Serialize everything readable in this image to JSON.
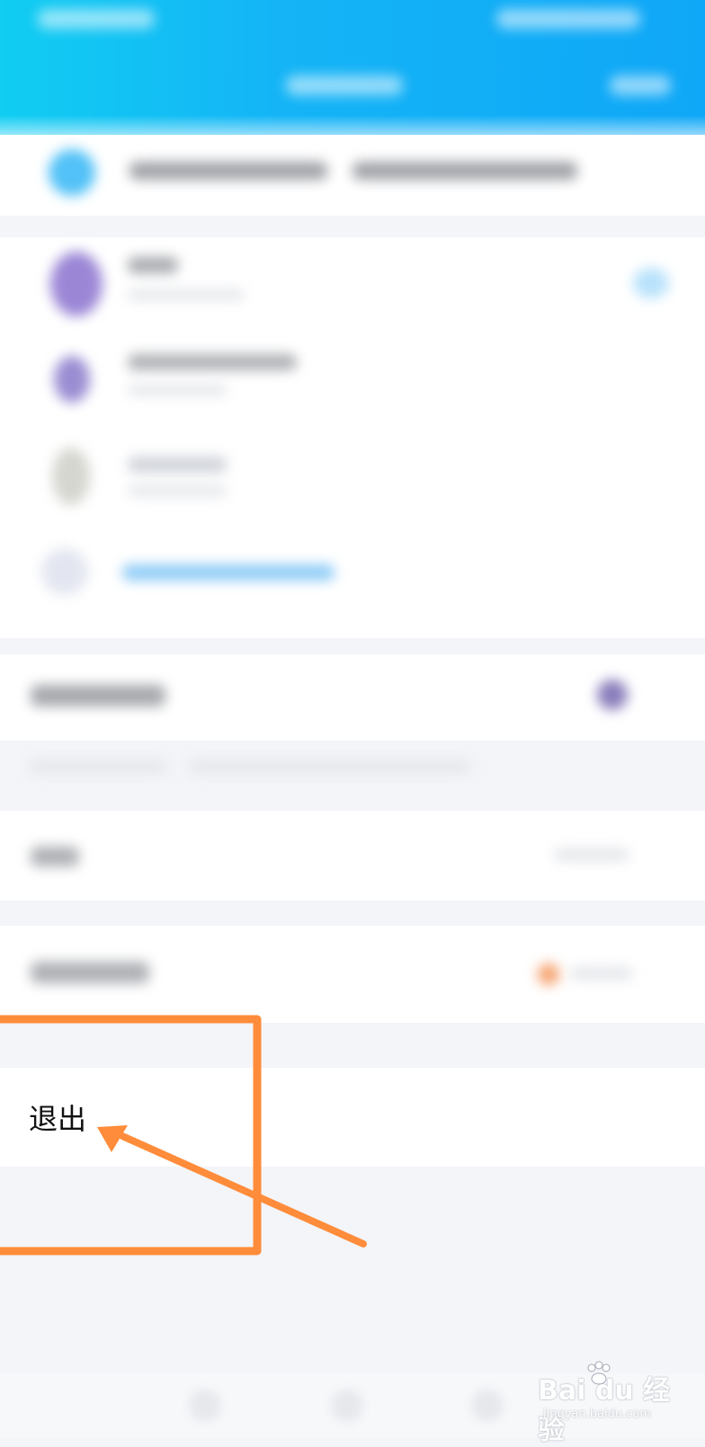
{
  "logout": {
    "label": "退出"
  },
  "watermark": {
    "brand": "Bai du 经验",
    "url": "jingyan.baidu.com"
  },
  "colors": {
    "header_start": "#11cdf2",
    "header_end": "#0fa7f7",
    "annotation": "#ff8c3a",
    "background": "#f3f5f9"
  },
  "icons": [
    "paw-icon",
    "arrow-icon"
  ]
}
